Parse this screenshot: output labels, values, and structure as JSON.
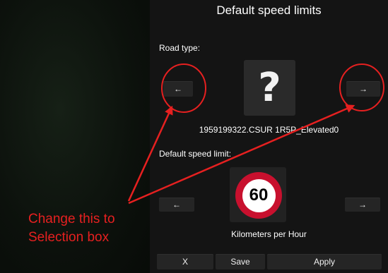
{
  "window": {
    "title": "Default speed limits"
  },
  "road_type": {
    "label": "Road type:",
    "prev_label": "←",
    "next_label": "→",
    "preview_icon": "question-mark-icon",
    "preview_glyph": "?",
    "name": "1959199322.CSUR 1R5P_Elevated0"
  },
  "speed_limit": {
    "label": "Default speed limit:",
    "prev_label": "←",
    "next_label": "→",
    "sign_icon": "speed-limit-sign-icon",
    "value": "60",
    "unit": "Kilometers per Hour"
  },
  "footer": {
    "cancel_label": "X",
    "save_label": "Save",
    "apply_label": "Apply"
  },
  "annotation": {
    "line1": "Change this to",
    "line2": "Selection box",
    "color": "#e62020"
  }
}
